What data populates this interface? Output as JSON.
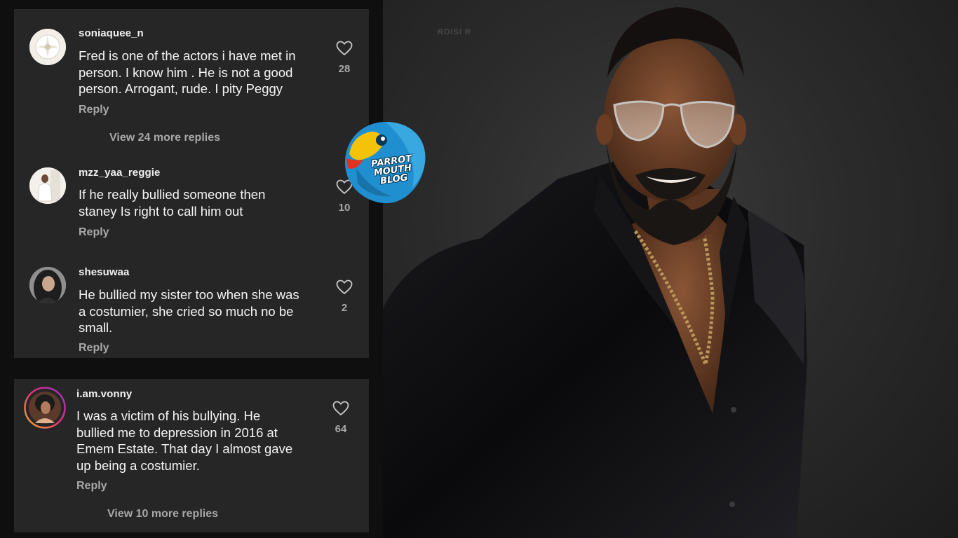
{
  "comments_top": [
    {
      "username": "soniaquee_n",
      "text": "Fred is one of the actors i have met in\nperson. I know  him . He is not a good\nperson. Arrogant, rude. I pity Peggy",
      "likes": "28",
      "reply_label": "Reply",
      "view_more": "View 24 more replies"
    },
    {
      "username": "mzz_yaa_reggie",
      "text": "If he really bullied someone then\nstaney Is right to call him out",
      "likes": "10",
      "reply_label": "Reply"
    },
    {
      "username": "shesuwaa",
      "text": "He bullied my sister too when she was\na costumier,  she  cried so much no be\nsmall.",
      "likes": "2",
      "reply_label": "Reply"
    }
  ],
  "comments_bottom": [
    {
      "username": "i.am.vonny",
      "text": "I was a victim of his bullying. He\nbullied me to depression in 2016 at\nEmem Estate. That day I almost gave\nup being a costumier.",
      "likes": "64",
      "reply_label": "Reply",
      "view_more": "View 10 more replies"
    }
  ],
  "logo": {
    "text": "PARROT\nMOUTH\nBLOG",
    "colors": {
      "blue": "#1f8fd0",
      "yellow": "#f5c20a",
      "red": "#e2311d"
    }
  },
  "photo": {
    "watermark": "ROISI R"
  },
  "colors": {
    "panel_bg": "#262626",
    "text_primary": "#f5f5f5",
    "text_secondary": "#a8a8a8"
  }
}
